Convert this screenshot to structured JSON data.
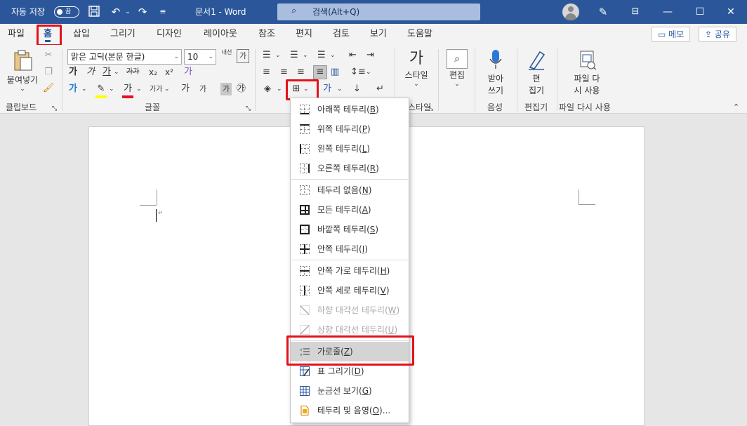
{
  "titlebar": {
    "autosave_label": "자동 저장",
    "autosave_state": "끔",
    "doc_title": "문서1  -  Word",
    "search_placeholder": "검색(Alt+Q)"
  },
  "tabs": [
    "파일",
    "홈",
    "삽입",
    "그리기",
    "디자인",
    "레이아웃",
    "참조",
    "편지",
    "검토",
    "보기",
    "도움말"
  ],
  "active_tab": "홈",
  "top_buttons": {
    "memo": "메모",
    "share": "공유"
  },
  "ribbon": {
    "clipboard": {
      "paste": "붙여넣기",
      "group": "클립보드"
    },
    "font": {
      "font_name": "맑은 고딕(본문 한글)",
      "font_size": "10",
      "group": "글꼴",
      "bold": "가",
      "italic": "가",
      "underline": "가",
      "strike": "가가",
      "sub": "x₂",
      "sup": "x²",
      "char_shading": "가",
      "phonetic": "가",
      "enclosed": "㉮",
      "change_case": "가가",
      "grow": "가",
      "shrink": "가"
    },
    "styles": {
      "label": "스타일",
      "group": "스타일"
    },
    "editing": {
      "label": "편집"
    },
    "voice": {
      "label_line1": "받아",
      "label_line2": "쓰기",
      "group": "음성"
    },
    "editor": {
      "label_line1": "편",
      "label_line2": "집기",
      "group": "편집기"
    },
    "reuse": {
      "label_line1": "파일 다",
      "label_line2": "시 사용",
      "group": "파일 다시 사용"
    }
  },
  "border_menu": {
    "items": [
      {
        "label": "아래쪽 테두리",
        "key": "B",
        "icon": "bottom-border-icon",
        "enabled": true
      },
      {
        "label": "위쪽 테두리",
        "key": "P",
        "icon": "top-border-icon",
        "enabled": true
      },
      {
        "label": "왼쪽 테두리",
        "key": "L",
        "icon": "left-border-icon",
        "enabled": true
      },
      {
        "label": "오른쪽 테두리",
        "key": "R",
        "icon": "right-border-icon",
        "enabled": true
      },
      {
        "label": "테두리 없음",
        "key": "N",
        "icon": "no-border-icon",
        "enabled": true
      },
      {
        "label": "모든 테두리",
        "key": "A",
        "icon": "all-borders-icon",
        "enabled": true
      },
      {
        "label": "바깥쪽 테두리",
        "key": "S",
        "icon": "outside-borders-icon",
        "enabled": true
      },
      {
        "label": "안쪽 테두리",
        "key": "I",
        "icon": "inside-borders-icon",
        "enabled": true
      },
      {
        "label": "안쪽 가로 테두리",
        "key": "H",
        "icon": "inside-horizontal-border-icon",
        "enabled": true
      },
      {
        "label": "안쪽 세로 테두리",
        "key": "V",
        "icon": "inside-vertical-border-icon",
        "enabled": true
      },
      {
        "label": "하향 대각선 테두리",
        "key": "W",
        "icon": "diagonal-down-border-icon",
        "enabled": false
      },
      {
        "label": "상향 대각선 테두리",
        "key": "U",
        "icon": "diagonal-up-border-icon",
        "enabled": false
      },
      {
        "label": "가로줄",
        "key": "Z",
        "icon": "horizontal-line-icon",
        "enabled": true,
        "highlighted": true
      },
      {
        "label": "표 그리기",
        "key": "D",
        "icon": "draw-table-icon",
        "enabled": true
      },
      {
        "label": "눈금선 보기",
        "key": "G",
        "icon": "view-gridlines-icon",
        "enabled": true
      },
      {
        "label": "테두리 및 음영",
        "key": "O",
        "suffix": "...",
        "icon": "borders-shading-icon",
        "enabled": true
      }
    ]
  },
  "colors": {
    "titlebar": "#2b579a",
    "accent": "#2b579a",
    "highlight_box": "#e3121a",
    "font_color_bar": "#e81123",
    "highlight_color_bar": "#ffff00"
  }
}
